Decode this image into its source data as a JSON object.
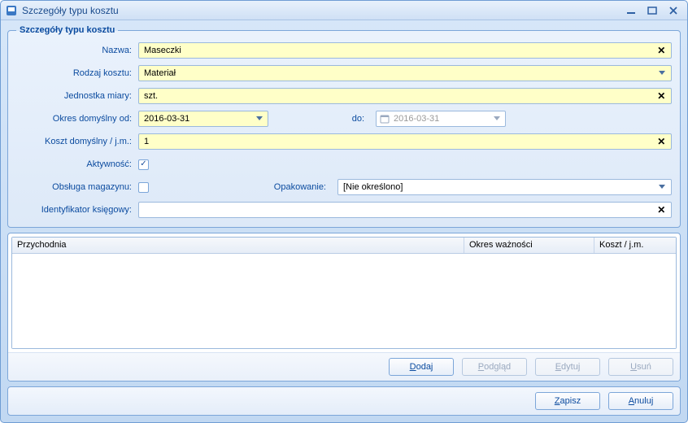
{
  "window": {
    "title": "Szczegóły typu kosztu"
  },
  "groupbox": {
    "legend": "Szczegóły typu kosztu"
  },
  "labels": {
    "nazwa": "Nazwa:",
    "rodzaj": "Rodzaj kosztu:",
    "jednostka": "Jednostka miary:",
    "okres_od": "Okres domyślny od:",
    "do": "do:",
    "koszt_jm": "Koszt domyślny / j.m.:",
    "aktywnosc": "Aktywność:",
    "magazyn": "Obsługa magazynu:",
    "opakowanie": "Opakowanie:",
    "ident": "Identyfikator księgowy:"
  },
  "values": {
    "nazwa": "Maseczki",
    "rodzaj": "Materiał",
    "jednostka": "szt.",
    "okres_od": "2016-03-31",
    "okres_do": "2016-03-31",
    "koszt_jm": "1",
    "aktywnosc": true,
    "magazyn": false,
    "opakowanie": "[Nie określono]",
    "ident": ""
  },
  "grid": {
    "columns": {
      "przychodnia": "Przychodnia",
      "okres": "Okres ważności",
      "koszt": "Koszt / j.m."
    },
    "rows": []
  },
  "buttons": {
    "dodaj": "Dodaj",
    "podglad": "Podgląd",
    "edytuj": "Edytuj",
    "usun": "Usuń",
    "zapisz": "Zapisz",
    "anuluj": "Anuluj"
  }
}
